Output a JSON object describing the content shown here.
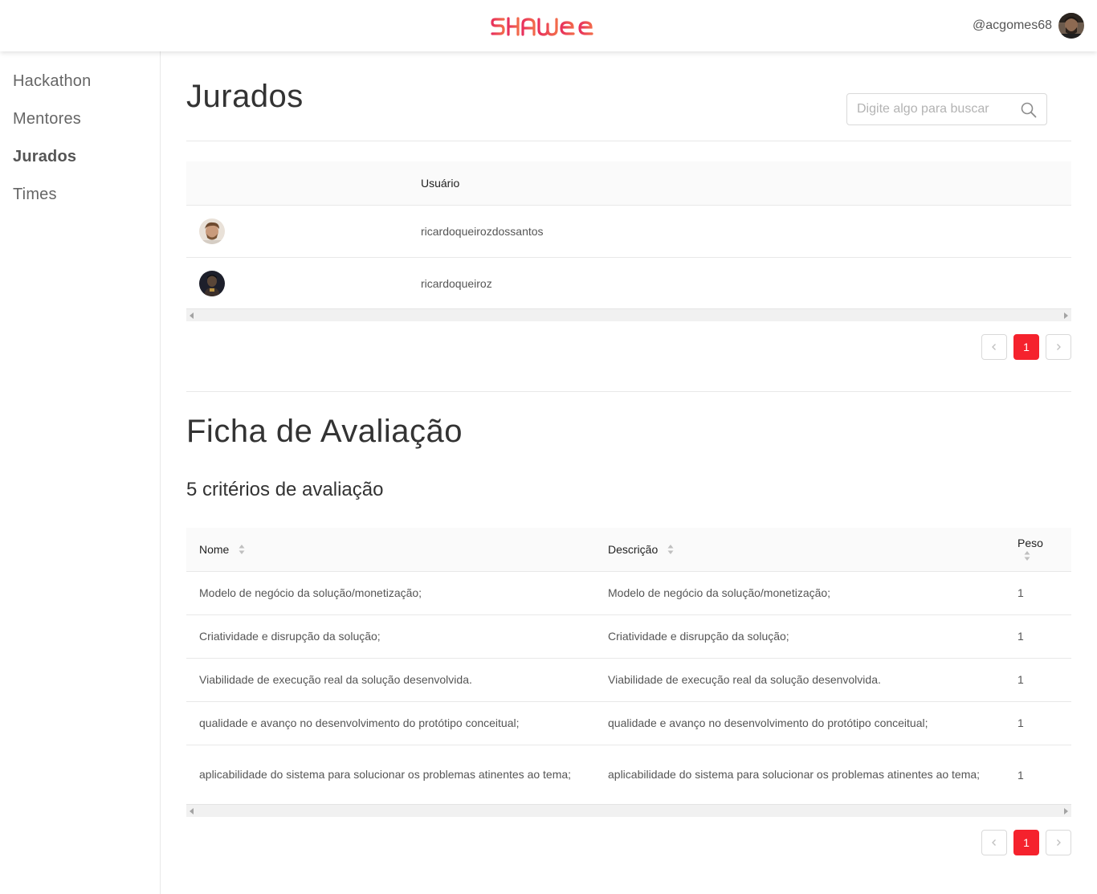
{
  "header": {
    "logo_text": "SHAWEE",
    "username": "@acgomes68",
    "brand_color": "#f5222d"
  },
  "sidebar": {
    "items": [
      {
        "label": "Hackathon",
        "active": false
      },
      {
        "label": "Mentores",
        "active": false
      },
      {
        "label": "Jurados",
        "active": true
      },
      {
        "label": "Times",
        "active": false
      }
    ]
  },
  "jurados": {
    "title": "Jurados",
    "search_placeholder": "Digite algo para buscar",
    "table": {
      "columns": [
        "",
        "Usuário"
      ],
      "rows": [
        {
          "username": "ricardoqueirozdossantos"
        },
        {
          "username": "ricardoqueiroz"
        }
      ]
    },
    "pagination": {
      "prev_icon": "chevron-left-icon",
      "current_page": "1",
      "next_icon": "chevron-right-icon"
    }
  },
  "ficha": {
    "title": "Ficha de Avaliação",
    "subtitle": "5 critérios de avaliação",
    "table": {
      "columns": [
        "Nome",
        "Descrição",
        "Peso"
      ],
      "rows": [
        {
          "nome": "Modelo de negócio da solução/monetização;",
          "descricao": "Modelo de negócio da solução/monetização;",
          "peso": "1"
        },
        {
          "nome": "Criatividade e disrupção da solução;",
          "descricao": "Criatividade e disrupção da solução;",
          "peso": "1"
        },
        {
          "nome": "Viabilidade de execução real da solução desenvolvida.",
          "descricao": "Viabilidade de execução real da solução desenvolvida.",
          "peso": "1"
        },
        {
          "nome": "qualidade e avanço no desenvolvimento do protótipo conceitual;",
          "descricao": "qualidade e avanço no desenvolvimento do protótipo conceitual;",
          "peso": "1"
        },
        {
          "nome": "aplicabilidade do sistema para solucionar os problemas atinentes ao tema;",
          "descricao": "aplicabilidade do sistema para solucionar os problemas atinentes ao tema;",
          "peso": "1"
        }
      ]
    },
    "pagination": {
      "prev_icon": "chevron-left-icon",
      "current_page": "1",
      "next_icon": "chevron-right-icon"
    }
  }
}
